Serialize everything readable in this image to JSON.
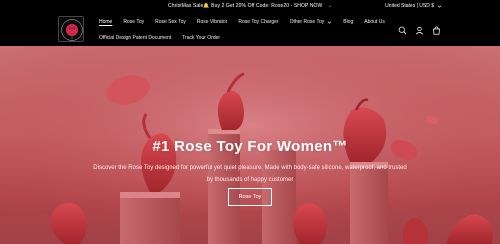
{
  "announcement": {
    "text": "ChristMas Sale🔔 Buy 2 Get 20% Off Code: Rose20 - SHOP NOW",
    "arrow_icon": "arrow-right-icon"
  },
  "locale": {
    "label": "United States | USD $",
    "icon": "chevron-down-icon"
  },
  "logo": {
    "alt": "Rose Toy logo"
  },
  "nav": {
    "row1": [
      {
        "label": "Home",
        "active": true
      },
      {
        "label": "Rose Toy"
      },
      {
        "label": "Rose Sex Toy"
      },
      {
        "label": "Rose Vibrator"
      },
      {
        "label": "Rose Toy Charger"
      },
      {
        "label": "Other Rose Toy",
        "has_dropdown": true
      },
      {
        "label": "Blog"
      },
      {
        "label": "About Us"
      }
    ],
    "row2": [
      {
        "label": "Official Design Patent Document"
      },
      {
        "label": "Track Your Order"
      }
    ]
  },
  "header_icons": [
    "search-icon",
    "account-icon",
    "cart-icon"
  ],
  "hero": {
    "title": "#1 Rose Toy For Women™",
    "subtitle": "Discover the Rose Toy designed for powerful yet quiet pleasure. Made with body-safe silicone, waterproof, and trusted by thousands of happy customer",
    "button_label": "Rose Toy"
  },
  "colors": {
    "header_bg": "#000000",
    "hero_bg": "#c25e62",
    "rose": "#c2343b",
    "text": "#ffffff"
  }
}
